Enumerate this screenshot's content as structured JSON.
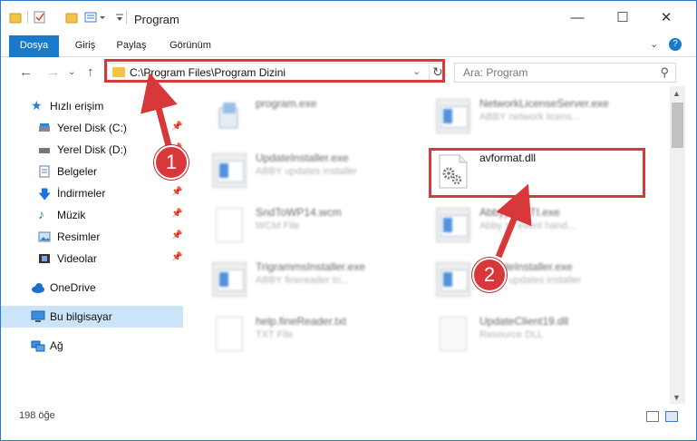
{
  "window": {
    "title": "Program"
  },
  "ribbon": {
    "tabs": [
      "Dosya",
      "Giriş",
      "Paylaş",
      "Görünüm"
    ]
  },
  "address": {
    "path": "C:\\Program Files\\Program Dizini",
    "search_placeholder": "Ara: Program"
  },
  "sidebar": {
    "items": [
      {
        "label": "Hızlı erişim",
        "icon": "star-icon"
      },
      {
        "label": "Yerel Disk (C:)",
        "icon": "drive-icon"
      },
      {
        "label": "Yerel Disk (D:)",
        "icon": "drive-icon"
      },
      {
        "label": "Belgeler",
        "icon": "documents-icon"
      },
      {
        "label": "İndirmeler",
        "icon": "download-icon"
      },
      {
        "label": "Müzik",
        "icon": "music-icon"
      },
      {
        "label": "Resimler",
        "icon": "pictures-icon"
      },
      {
        "label": "Videolar",
        "icon": "videos-icon"
      },
      {
        "label": "OneDrive",
        "icon": "cloud-icon"
      },
      {
        "label": "Bu bilgisayar",
        "icon": "computer-icon"
      },
      {
        "label": "Ağ",
        "icon": "network-icon"
      }
    ]
  },
  "files": [
    {
      "name": "program.exe",
      "desc": ""
    },
    {
      "name": "NetworkLicenseServer.exe",
      "desc": "ABBY network licens..."
    },
    {
      "name": "UpdateInstaller.exe",
      "desc": "ABBY updates installer"
    },
    {
      "name": "avformat.dll",
      "desc": ""
    },
    {
      "name": "SndToWP14.wcm",
      "desc": "WCM File"
    },
    {
      "name": "AbbyyEvSTI.exe",
      "desc": "Abby sti event hand..."
    },
    {
      "name": "TrigrammsInstaller.exe",
      "desc": "ABBY finereader tri..."
    },
    {
      "name": "UpdateInstaller.exe",
      "desc": "ABBY updates installer"
    },
    {
      "name": "help.fineReader.txt",
      "desc": "TXT File"
    },
    {
      "name": "UpdateClient19.dll",
      "desc": "Resource DLL"
    }
  ],
  "status": {
    "count": "198 öğe"
  },
  "annotations": {
    "step1": "1",
    "step2": "2"
  },
  "colors": {
    "accent": "#1979ca",
    "annotation": "#d9383a",
    "selected": "#cce4f7"
  }
}
